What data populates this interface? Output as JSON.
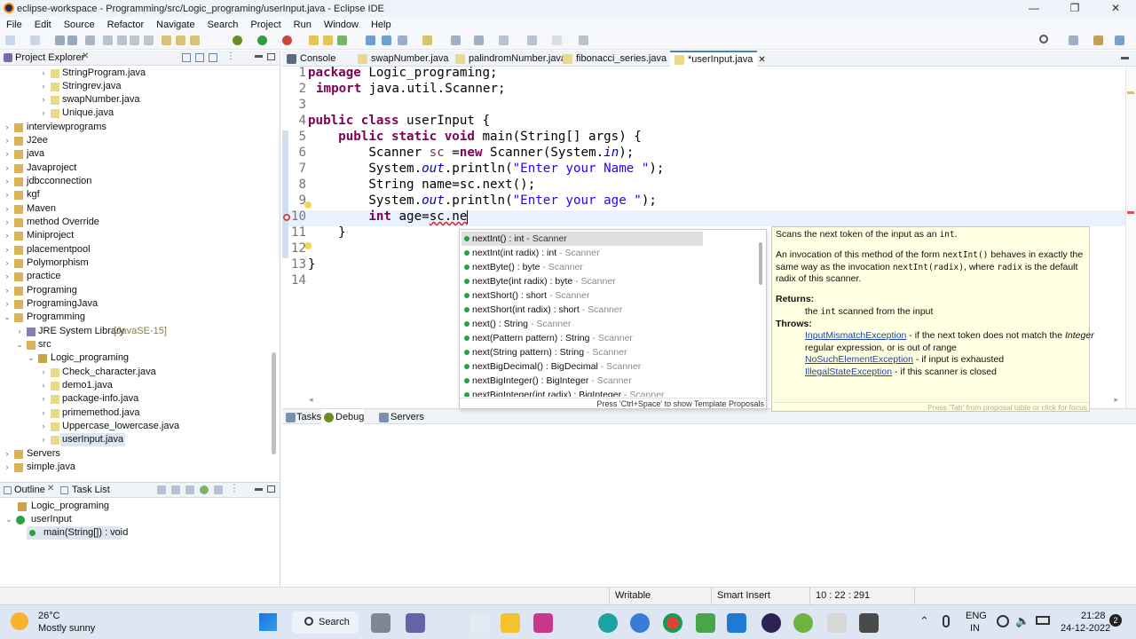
{
  "window": {
    "title": "eclipse-workspace - Programming/src/Logic_programing/userInput.java - Eclipse IDE",
    "controls": [
      "—",
      "❐",
      "✕"
    ]
  },
  "menu": [
    "File",
    "Edit",
    "Source",
    "Refactor",
    "Navigate",
    "Search",
    "Project",
    "Run",
    "Window",
    "Help"
  ],
  "explorer": {
    "title": "Project Explorer",
    "items": [
      {
        "label": "StringProgram.java"
      },
      {
        "label": "Stringrev.java"
      },
      {
        "label": "swapNumber.java"
      },
      {
        "label": "Unique.java"
      },
      {
        "label": "interviewprograms"
      },
      {
        "label": "J2ee"
      },
      {
        "label": "java"
      },
      {
        "label": "Javaproject"
      },
      {
        "label": "jdbcconnection"
      },
      {
        "label": "kgf"
      },
      {
        "label": "Maven"
      },
      {
        "label": "method Override"
      },
      {
        "label": "Miniproject"
      },
      {
        "label": "placementpool"
      },
      {
        "label": "Polymorphism"
      },
      {
        "label": "practice"
      },
      {
        "label": "Programing"
      },
      {
        "label": "ProgramingJava"
      },
      {
        "label": "Programming"
      },
      {
        "label": "JRE System Library",
        "suffix": "[JavaSE-15]"
      },
      {
        "label": "src"
      },
      {
        "label": "Logic_programing"
      },
      {
        "label": "Check_character.java"
      },
      {
        "label": "demo1.java"
      },
      {
        "label": "package-info.java"
      },
      {
        "label": "primemethod.java"
      },
      {
        "label": "Uppercase_lowercase.java"
      },
      {
        "label": "userInput.java"
      },
      {
        "label": "Servers"
      },
      {
        "label": "simple.java"
      }
    ]
  },
  "outline": {
    "tabs": [
      "Outline",
      "Task List"
    ],
    "items": [
      "Logic_programing",
      "userInput",
      "main(String[]) : void"
    ]
  },
  "editor_tabs": [
    "Console",
    "swapNumber.java",
    "palindromNumber.java",
    "fibonacci_series.java",
    "*userInput.java"
  ],
  "code": {
    "line_numbers": [
      "1",
      "2",
      "3",
      "4",
      "5",
      "6",
      "7",
      "8",
      "9",
      "10",
      "11",
      "12",
      "13",
      "14"
    ],
    "t": {
      "package": "package",
      "import": "import",
      "public": "public",
      "class": "class",
      "static": "static",
      "void": "void",
      "new": "new",
      "int": "int",
      "l1": " Logic_programing;",
      "l2": " java.util.Scanner;",
      "l4": " userInput {",
      "l5a": "    ",
      "l5b": " main(String[] args) {",
      "l6a": "        Scanner ",
      "l6b": "sc",
      "l6c": " =",
      "l6d": " Scanner(System.",
      "l6e": "in",
      "l6f": ");",
      "l7a": "        System.",
      "l7b": "out",
      "l7c": ".println(",
      "l7d": "\"Enter your Name \"",
      "l7e": ");",
      "l8": "        String name=sc.next();",
      "l9a": "        System.",
      "l9b": "out",
      "l9c": ".println(",
      "l9d": "\"Enter your age \"",
      "l9e": ");",
      "l10a": "        ",
      "l10b": " age=",
      "l10c": "sc.ne",
      "l11": "    }",
      "l13": "}"
    }
  },
  "proposals": {
    "items": [
      {
        "sig": "nextInt() : int",
        "q": " - Scanner"
      },
      {
        "sig": "nextInt(int radix) : int",
        "q": " - Scanner"
      },
      {
        "sig": "nextByte() : byte",
        "q": " - Scanner"
      },
      {
        "sig": "nextByte(int radix) : byte",
        "q": " - Scanner"
      },
      {
        "sig": "nextShort() : short",
        "q": " - Scanner"
      },
      {
        "sig": "nextShort(int radix) : short",
        "q": " - Scanner"
      },
      {
        "sig": "next() : String",
        "q": " - Scanner"
      },
      {
        "sig": "next(Pattern pattern) : String",
        "q": " - Scanner"
      },
      {
        "sig": "next(String pattern) : String",
        "q": " - Scanner"
      },
      {
        "sig": "nextBigDecimal() : BigDecimal",
        "q": " - Scanner"
      },
      {
        "sig": "nextBigInteger() : BigInteger",
        "q": " - Scanner"
      },
      {
        "sig": "nextBigInteger(int radix) : BigInteger",
        "q": " - Scanner"
      }
    ],
    "footer": "Press 'Ctrl+Space' to show Template Proposals"
  },
  "doc": {
    "l1a": "Scans the next token of the input as an ",
    "l1b": "int",
    "l1c": ".",
    "l2a": "An invocation of this method of the form ",
    "l2b": "nextInt()",
    "l2c": " behaves in exactly the",
    "l3a": "same way as the invocation ",
    "l3b": "nextInt(radix)",
    "l3c": ", where ",
    "l3d": "radix",
    "l3e": " is the default",
    "l4": "radix of this scanner.",
    "returns": "Returns:",
    "r1a": "the ",
    "r1b": "int",
    "r1c": " scanned from the input",
    "throws": "Throws:",
    "e1": "InputMismatchException",
    "e1t": " - if the next token does not match the ",
    "e1i": "Integer",
    "e1t2": "regular expression, or is out of range",
    "e2": "NoSuchElementException",
    "e2t": " - if input is exhausted",
    "e3": "IllegalStateException",
    "e3t": " - if this scanner is closed",
    "footer": "Press 'Tab' from proposal table or click for focus"
  },
  "bottom_tabs": [
    "Tasks",
    "Debug",
    "Servers"
  ],
  "status": {
    "mode": "Writable",
    "insert": "Smart Insert",
    "position": "10 : 22 : 291"
  },
  "taskbar": {
    "weather_temp": "26°C",
    "weather_desc": "Mostly sunny",
    "search": "Search",
    "lang1": "ENG",
    "lang2": "IN",
    "time": "21:28",
    "date": "24-12-2022",
    "badge": "2"
  }
}
